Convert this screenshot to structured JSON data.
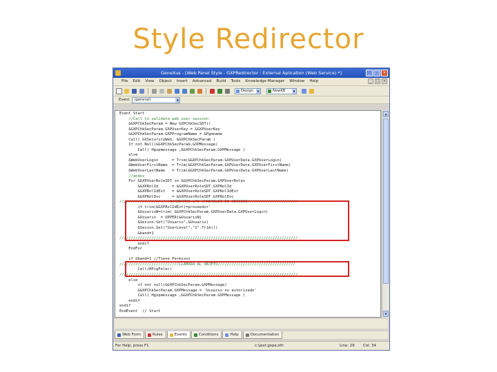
{
  "slide": {
    "title": "Style Redirector"
  },
  "window": {
    "title": "GeneXus - [Web Panel Style - GXPRedirector : External Aplication (Web Service) *]",
    "menu": [
      "File",
      "Edit",
      "View",
      "Object",
      "Insert",
      "Advanced",
      "Build",
      "Tools",
      "Knowledge Manager",
      "Window",
      "Help"
    ],
    "toolbar": {
      "design_combo": "Design",
      "model_combo": "NewKB"
    },
    "event_label": "Event",
    "event_value": "(general)"
  },
  "code_lines": [
    "Event Start",
    "    //Call to validate web user session",
    "    &GXPChkSecParam = New GXPChkSecSDT()",
    "    &GXPChkSecParam.GXPUserKey = &GXPUserKey",
    "    &GXPChkSecParam.GXPProgramName = &Pgmname",
    "    Call( GXSecurityWeb, &GXPChkSecParam )",
    "    If not Null(&GXPChkSecParam.GXPMessage)",
    "        Call( Hgxpmessage ,&GXPChkSecParam.GXPMessage )",
    "    else",
    "    &WebUserLogin      = Trim(&GXPChkSecParam.GXPUserData.GXPUserLogin)",
    "    &WebUserFirstName  = Trim(&GXPChkSecParam.GXPUserData.GXPUserFirstName)",
    "    &WebUserLastName   = Trim(&GXPChkSecParam.GXPUserData.GXPUserLastName)",
    "    //endsv",
    "    For &GXPUserRoleSDT in &GXPChkSecParam.GXPUserRoles",
    "        &GXPRolId      = &GXPUserRoleSDT.GXPRolId",
    "        &GXPRolIdExt   = &GXPUserRoleSDT.GXPRolIdExt",
    "        &GXPRolDsc     = &GXPUserRoleSDT.GXPRolDsc",
    "//////////////////////GUARDAMOS LAS VARIABLES DE SESSION//////////////////////",
    "        if trim(&GXPRolIdExt)=proveedor'",
    "        &UsuarioN=trim( &GXPChkSecParam.GXPUserData.GXPUserLogin)",
    "        &Usuario  = UPPER(&UsuarioN)",
    "        &Sesion.Set(\"Usuario\",&Usuario)",
    "        &Sesion.Set(\"UserLevel\",\"1\".Trim())",
    "        &band=1",
    "//////////////////////////////////////////////////////////////////////////////",
    "        endif",
    "    EndFor",
    "",
    "    if &band=1 //Tiene Permisos",
    "//////////////////////////LLAMADA AL OBJETO//////////////////////////////////",
    "        Call(HPigFeler)",
    "//////////////////////////////////////////////////////////////////////////////",
    "    else",
    "        if not null(&GXPChkSecParam.GXPMessage)",
    "        &GXPChkSecParam.GXPMessage = 'Usuario no autorizado'",
    "        Call( Hgxpmessage ,&GXPChkSecParam.GXPMessage )",
    "    endif",
    "endif",
    "EndEvent  // Start"
  ],
  "tabs": [
    "Web Form",
    "Rules",
    "Events",
    "Conditions",
    "Help",
    "Documentation"
  ],
  "status": {
    "help": "For Help, press F1",
    "path": "c:\\jext.gxpa.sth",
    "line": "Line: 29",
    "col": "Col: 34"
  },
  "colors": {
    "title": "#e6a531",
    "highlight": "#d42020",
    "titlebar": "#2452b8"
  }
}
